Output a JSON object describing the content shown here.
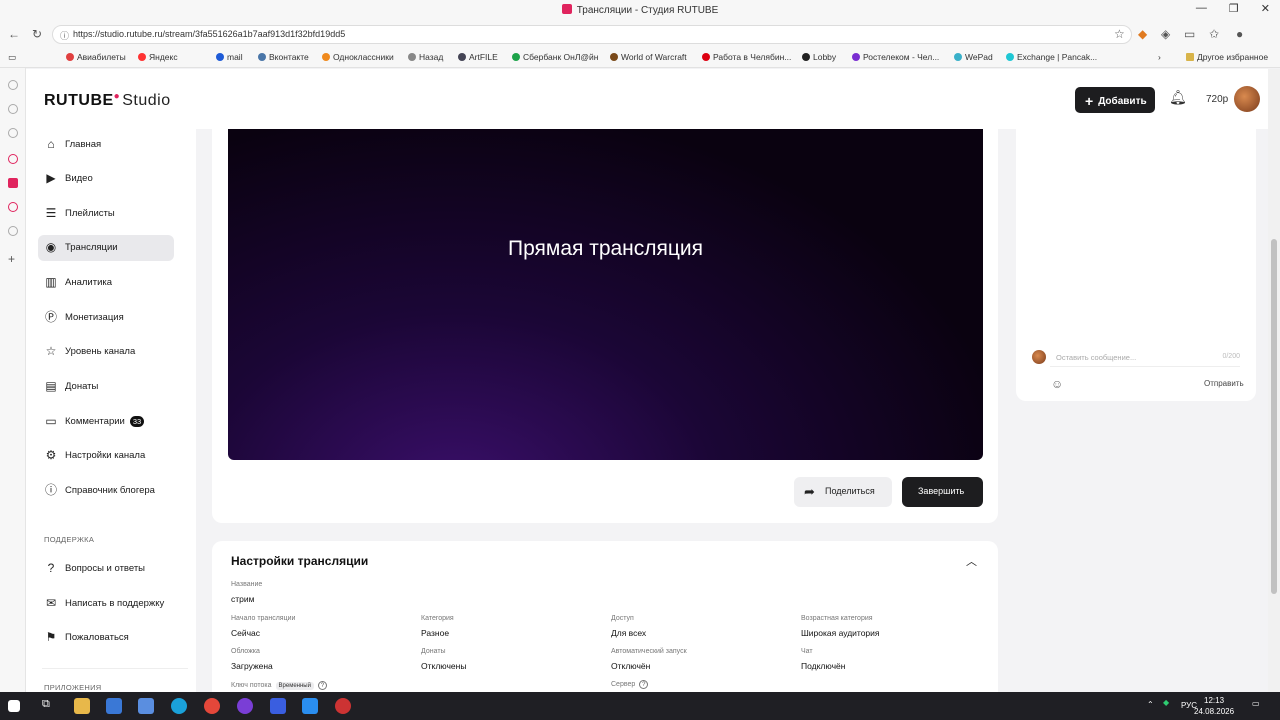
{
  "browser": {
    "window_title": "Трансляции - Студия RUTUBE",
    "url": "https://studio.rutube.ru/stream/3fa551626a1b7aaf913d1f32bfd19dd5",
    "bookmarks": [
      "Авиабилеты",
      "Яндекс",
      "mail",
      "Вконтакте",
      "Одноклассники",
      "Назад",
      "ArtFILE",
      "Сбербанк ОнЛ@йн",
      "World of Warcraft",
      "Работа в Челябин...",
      "Lobby",
      "Ростелеком - Чел...",
      "WePad",
      "Exchange | Pancak..."
    ],
    "other_bookmarks": "Другое избранное"
  },
  "header": {
    "logo_brand": "RUTUBE",
    "logo_product": "Studio",
    "add_button": "Добавить",
    "quality": "720p"
  },
  "sidebar": {
    "items": [
      {
        "label": "Главная",
        "icon": "home-icon"
      },
      {
        "label": "Видео",
        "icon": "video-icon"
      },
      {
        "label": "Плейлисты",
        "icon": "playlist-icon"
      },
      {
        "label": "Трансляции",
        "icon": "broadcast-icon"
      },
      {
        "label": "Аналитика",
        "icon": "analytics-icon"
      },
      {
        "label": "Монетизация",
        "icon": "money-icon"
      },
      {
        "label": "Уровень канала",
        "icon": "star-icon"
      },
      {
        "label": "Донаты",
        "icon": "gift-icon"
      },
      {
        "label": "Комментарии",
        "icon": "comment-icon",
        "badge": "33"
      },
      {
        "label": "Настройки канала",
        "icon": "settings-icon"
      },
      {
        "label": "Справочник блогера",
        "icon": "info-icon"
      }
    ],
    "support_title": "ПОДДЕРЖКА",
    "support_items": [
      {
        "label": "Вопросы и ответы",
        "icon": "question-icon"
      },
      {
        "label": "Написать в поддержку",
        "icon": "mail-icon"
      },
      {
        "label": "Пожаловаться",
        "icon": "flag-icon"
      }
    ],
    "apps_title": "ПРИЛОЖЕНИЯ"
  },
  "player": {
    "title": "Прямая трансляция",
    "share_button": "Поделиться",
    "end_button": "Завершить"
  },
  "settings": {
    "title": "Настройки трансляции",
    "name_label": "Название",
    "name_value": "стрим",
    "fields": [
      {
        "label": "Начало трансляции",
        "value": "Сейчас"
      },
      {
        "label": "Категория",
        "value": "Разное"
      },
      {
        "label": "Доступ",
        "value": "Для всех"
      },
      {
        "label": "Возрастная категория",
        "value": "Широкая аудитория"
      },
      {
        "label": "Обложка",
        "value": "Загружена"
      },
      {
        "label": "Донаты",
        "value": "Отключены"
      },
      {
        "label": "Автоматический запуск",
        "value": "Отключён"
      },
      {
        "label": "Чат",
        "value": "Подключён"
      }
    ],
    "stream_key_label": "Ключ потока",
    "stream_key_tag": "Временный",
    "server_label": "Сервер"
  },
  "chat": {
    "placeholder": "Оставить сообщение...",
    "counter": "0/200",
    "send": "Отправить"
  },
  "taskbar": {
    "lang": "РУС",
    "time": "12:13",
    "date": "24.08.2026"
  }
}
